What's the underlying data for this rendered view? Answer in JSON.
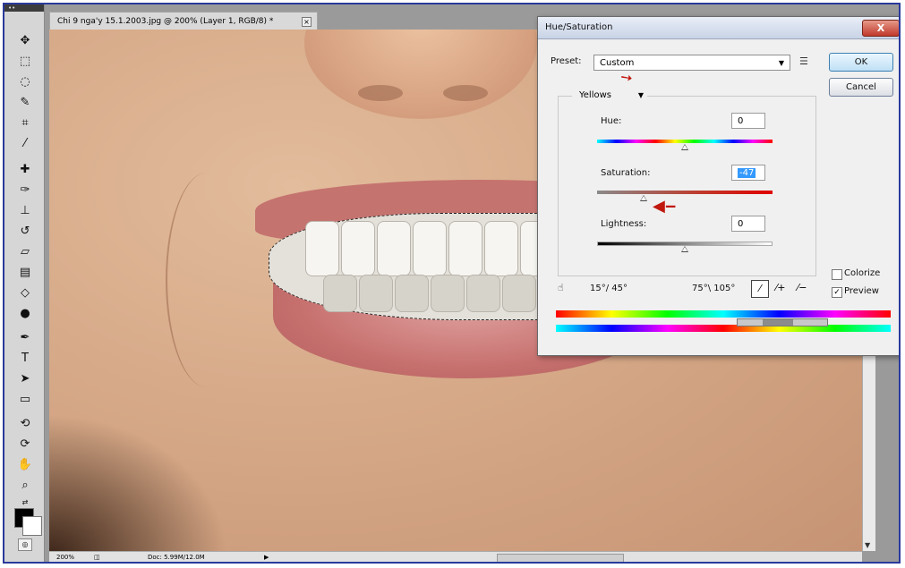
{
  "document": {
    "tab_title": "Chi 9 nga'y 15.1.2003.jpg @ 200% (Layer 1, RGB/8) *",
    "tab_close": "×",
    "zoom": "200%",
    "doc_info": "Doc: 5.99M/12.0M"
  },
  "tools": {
    "grip": "••"
  },
  "dialog": {
    "title": "Hue/Saturation",
    "close_label": "X",
    "preset_label": "Preset:",
    "preset_value": "Custom",
    "ok_label": "OK",
    "cancel_label": "Cancel",
    "channel_value": "Yellows",
    "hue_label": "Hue:",
    "hue_value": "0",
    "hue_position": 0.5,
    "saturation_label": "Saturation:",
    "saturation_value": "-47",
    "saturation_position": 0.265,
    "lightness_label": "Lightness:",
    "lightness_value": "0",
    "lightness_position": 0.5,
    "range_left": "15°/ 45°",
    "range_right": "75°\\ 105°",
    "colorize_label": "Colorize",
    "colorize_checked": false,
    "preview_label": "Preview",
    "preview_checked": true
  },
  "colors": {
    "selection_highlight": "#3399ff",
    "annotation_arrow": "#c0180e",
    "close_button": "#c0392b",
    "frame_border": "#2a3a9c"
  }
}
